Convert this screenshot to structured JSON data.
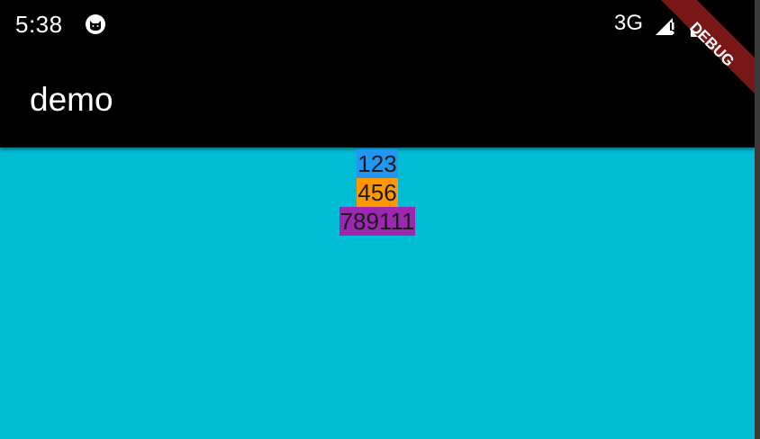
{
  "status_bar": {
    "time": "5:38",
    "network": "3G",
    "icons": [
      "cat-notification-icon",
      "cellular-signal-icon",
      "battery-icon"
    ]
  },
  "app_bar": {
    "title": "demo"
  },
  "content": {
    "items": [
      {
        "text": "123",
        "color": "#2196f3"
      },
      {
        "text": "456",
        "color": "#ff9800"
      },
      {
        "text": "789111",
        "color": "#9c27b0"
      }
    ]
  },
  "debug_banner": {
    "label": "DEBUG",
    "color": "#7b1616"
  },
  "colors": {
    "background": "#00bcd4",
    "app_bar": "#000000",
    "status_bar": "#000000"
  }
}
